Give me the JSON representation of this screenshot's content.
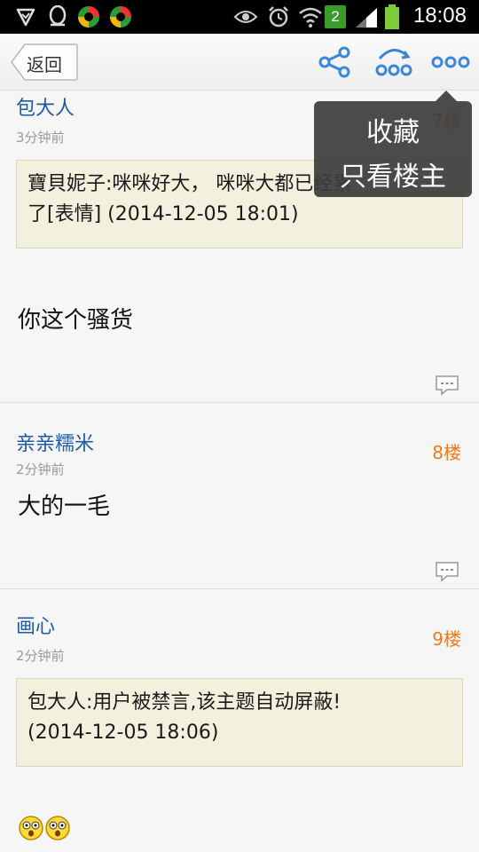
{
  "status_bar": {
    "time": "18:08",
    "sim_badge": "2",
    "icons": [
      "check-shield-icon",
      "qq-icon",
      "app-icon",
      "app-icon",
      "eye-icon",
      "alarm-icon",
      "wifi-icon",
      "signal-icon",
      "battery-icon"
    ]
  },
  "action_bar": {
    "back_label": "返回",
    "icons": [
      "share-icon",
      "more-options-icon",
      "overflow-icon"
    ]
  },
  "popup_menu": {
    "items": [
      "收藏",
      "只看楼主"
    ]
  },
  "posts": [
    {
      "username": "包大人",
      "time": "3分钟前",
      "floor": "7楼",
      "quote_line1": "寶貝妮子:咪咪好大， 咪咪大都已经累",
      "quote_line2": "了[表情] (2014-12-05 18:01)",
      "body": "你这个骚货"
    },
    {
      "username": "亲亲糯米",
      "time": "2分钟前",
      "floor": "8楼",
      "body": "大的一毛"
    },
    {
      "username": "画心",
      "time": "2分钟前",
      "floor": "9楼",
      "quote_line1": "包大人:用户被禁言,该主题自动屏蔽!",
      "quote_line2": "(2014-12-05 18:06)"
    }
  ],
  "colors": {
    "username": "#1f5aa6",
    "floor": "#f07a1a",
    "quote_bg": "#f2f1dd"
  }
}
